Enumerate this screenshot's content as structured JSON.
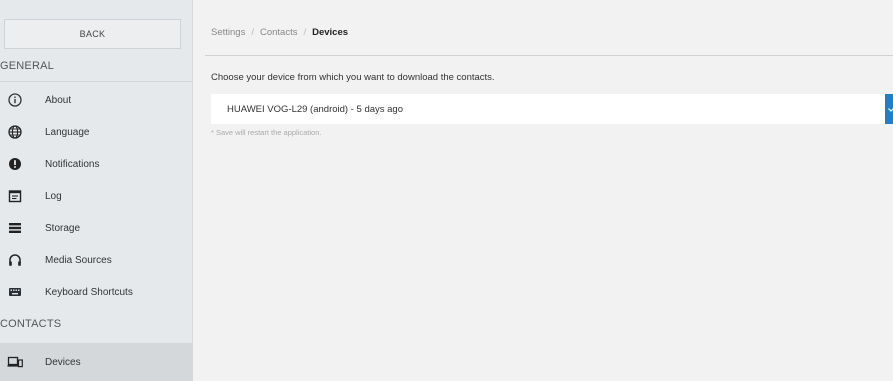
{
  "sidebar": {
    "back_label": "BACK",
    "section_general": "GENERAL",
    "section_contacts": "CONTACTS",
    "items": [
      {
        "label": "About",
        "icon": "info-icon"
      },
      {
        "label": "Language",
        "icon": "globe-icon"
      },
      {
        "label": "Notifications",
        "icon": "alert-icon"
      },
      {
        "label": "Log",
        "icon": "log-icon"
      },
      {
        "label": "Storage",
        "icon": "storage-icon"
      },
      {
        "label": "Media Sources",
        "icon": "headphones-icon"
      },
      {
        "label": "Keyboard Shortcuts",
        "icon": "keyboard-icon"
      }
    ],
    "contacts_items": [
      {
        "label": "Devices",
        "icon": "devices-icon",
        "selected": true
      }
    ]
  },
  "breadcrumb": {
    "items": [
      "Settings",
      "Contacts"
    ],
    "current": "Devices",
    "separator": "/"
  },
  "main": {
    "description": "Choose your device from which you want to download the contacts.",
    "device_select_value": "HUAWEI VOG-L29 (android) - 5 days ago",
    "note": "* Save will restart the application."
  },
  "colors": {
    "sidebar_bg": "#e6e9ec",
    "selected_bg": "#d5d8db",
    "main_bg": "#f2f2f2",
    "accent": "#1f7fc9"
  }
}
